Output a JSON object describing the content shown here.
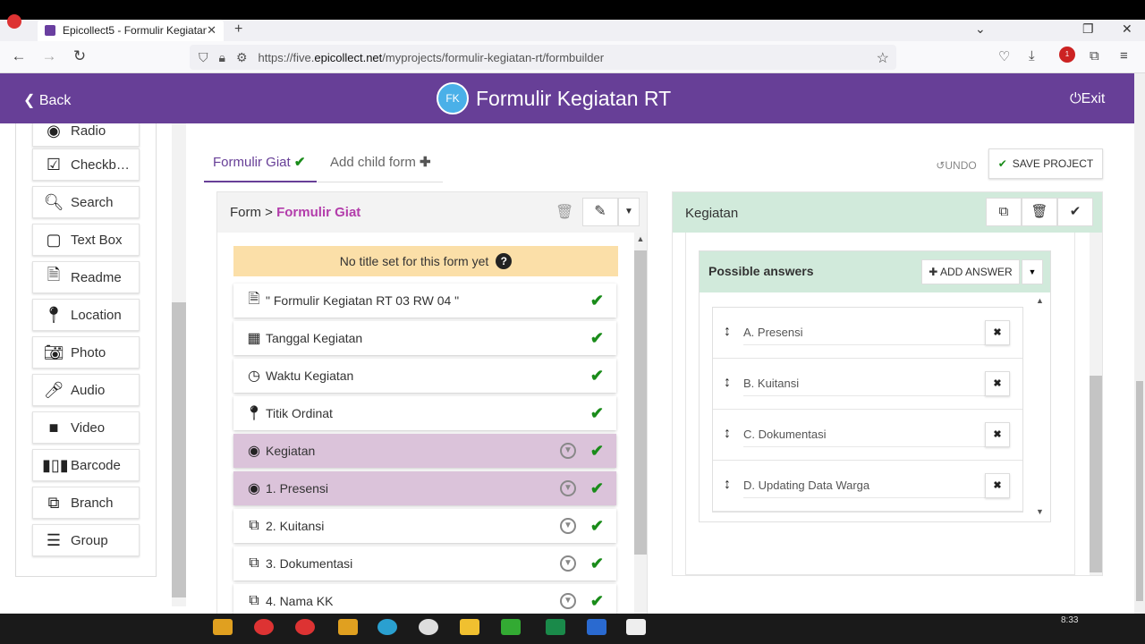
{
  "browser": {
    "tab_title": "Epicollect5 - Formulir Kegiatan",
    "tab_close": "✕",
    "new_tab": "+",
    "url_prefix": "https://five.",
    "url_host": "epicollect.net",
    "url_path": "/myprojects/formulir-kegiatan-rt/formbuilder",
    "ext_badge": "1"
  },
  "header": {
    "back_label": "Back",
    "logo_initials": "FK",
    "project_title": "Formulir Kegiatan RT",
    "exit_label": "Exit",
    "color": "#673f97"
  },
  "palette": {
    "items": [
      {
        "label": "Radio",
        "icon": "radio-icon"
      },
      {
        "label": "Checkb…",
        "icon": "checkbox-icon"
      },
      {
        "label": "Search",
        "icon": "search-icon"
      },
      {
        "label": "Text Box",
        "icon": "textbox-icon"
      },
      {
        "label": "Readme",
        "icon": "readme-icon"
      },
      {
        "label": "Location",
        "icon": "location-icon"
      },
      {
        "label": "Photo",
        "icon": "photo-icon"
      },
      {
        "label": "Audio",
        "icon": "audio-icon"
      },
      {
        "label": "Video",
        "icon": "video-icon"
      },
      {
        "label": "Barcode",
        "icon": "barcode-icon"
      },
      {
        "label": "Branch",
        "icon": "branch-icon"
      },
      {
        "label": "Group",
        "icon": "group-icon"
      }
    ]
  },
  "tabs": {
    "form_tab": "Formulir Giat",
    "add_child": "Add child form"
  },
  "toolbar": {
    "undo": "UNDO",
    "save": "SAVE PROJECT"
  },
  "form_panel": {
    "breadcrumb_prefix": "Form >",
    "form_name": "Formulir Giat",
    "no_title": "No title set for this form yet",
    "questions": [
      {
        "label": "\" Formulir Kegiatan RT 03 RW 04 \"",
        "icon": "readme-icon",
        "selected": false,
        "download": false
      },
      {
        "label": "Tanggal Kegiatan",
        "icon": "calendar-icon",
        "selected": false,
        "download": false
      },
      {
        "label": "Waktu Kegiatan",
        "icon": "clock-icon",
        "selected": false,
        "download": false
      },
      {
        "label": "Titik Ordinat",
        "icon": "location-icon",
        "selected": false,
        "download": false
      },
      {
        "label": "Kegiatan",
        "icon": "radio-icon",
        "selected": true,
        "download": true
      },
      {
        "label": "1. Presensi",
        "icon": "radio-icon",
        "selected": true,
        "download": true
      },
      {
        "label": "2. Kuitansi",
        "icon": "branch-icon",
        "selected": false,
        "download": true
      },
      {
        "label": "3. Dokumentasi",
        "icon": "branch-icon",
        "selected": false,
        "download": true
      },
      {
        "label": "4. Nama KK",
        "icon": "branch-icon",
        "selected": false,
        "download": true
      }
    ]
  },
  "right_panel": {
    "title": "Kegiatan",
    "possible_answers": "Possible answers",
    "add_answer": "ADD ANSWER",
    "answers": [
      "A. Presensi",
      "B. Kuitansi",
      "C. Dokumentasi",
      "D. Updating Data Warga"
    ]
  },
  "taskbar": {
    "clock": "8:33"
  }
}
